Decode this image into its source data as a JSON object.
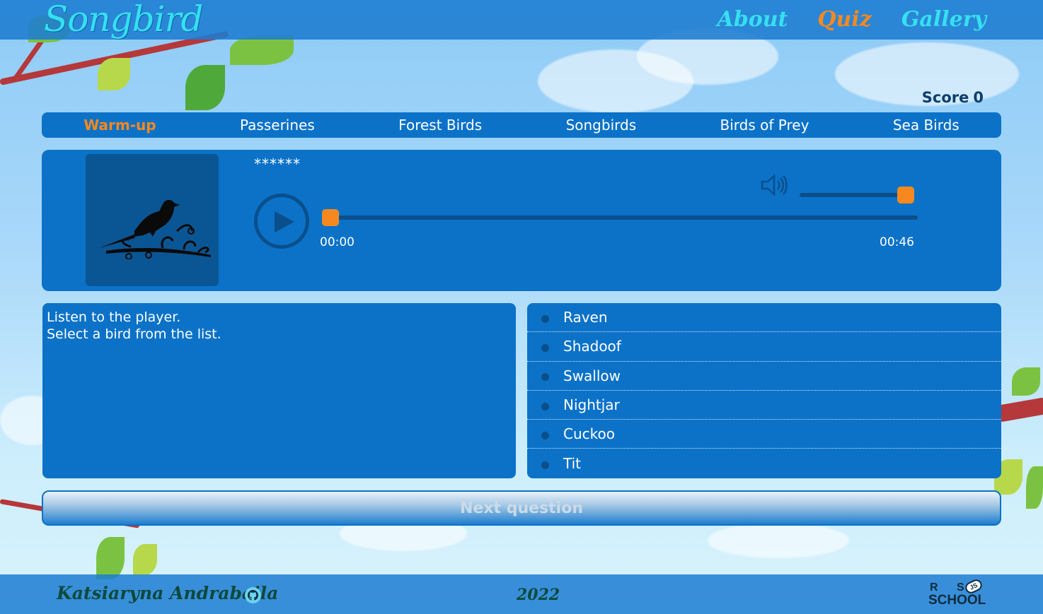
{
  "header": {
    "logo": "Songbird",
    "nav": [
      {
        "label": "About"
      },
      {
        "label": "Quiz"
      },
      {
        "label": "Gallery"
      }
    ]
  },
  "score": {
    "label": "Score",
    "value": "0"
  },
  "categories": [
    {
      "label": "Warm-up"
    },
    {
      "label": "Passerines"
    },
    {
      "label": "Forest Birds"
    },
    {
      "label": "Songbirds"
    },
    {
      "label": "Birds of Prey"
    },
    {
      "label": "Sea Birds"
    }
  ],
  "player": {
    "masked_name": "******",
    "current_time": "00:00",
    "duration": "00:46",
    "progress_fraction": 0.0,
    "volume_fraction": 1.0,
    "icons": {
      "play": "play-icon",
      "volume": "volume-icon",
      "bird": "bird-silhouette"
    }
  },
  "description": {
    "line1": "Listen to the player.",
    "line2": "Select a bird from the list."
  },
  "answers": [
    {
      "label": "Raven"
    },
    {
      "label": "Shadoof"
    },
    {
      "label": "Swallow"
    },
    {
      "label": "Nightjar"
    },
    {
      "label": "Cuckoo"
    },
    {
      "label": "Tit"
    }
  ],
  "next_button": {
    "label": "Next question"
  },
  "footer": {
    "author": "Katsiaryna Andrabaila",
    "year": "2022",
    "rs_logo": {
      "r": "R",
      "s": "S",
      "js": "JS",
      "school": "SCHOOL"
    }
  },
  "colors": {
    "accent": "#f5891f",
    "panel": "#0b72c8",
    "logo": "#35e0f0"
  }
}
